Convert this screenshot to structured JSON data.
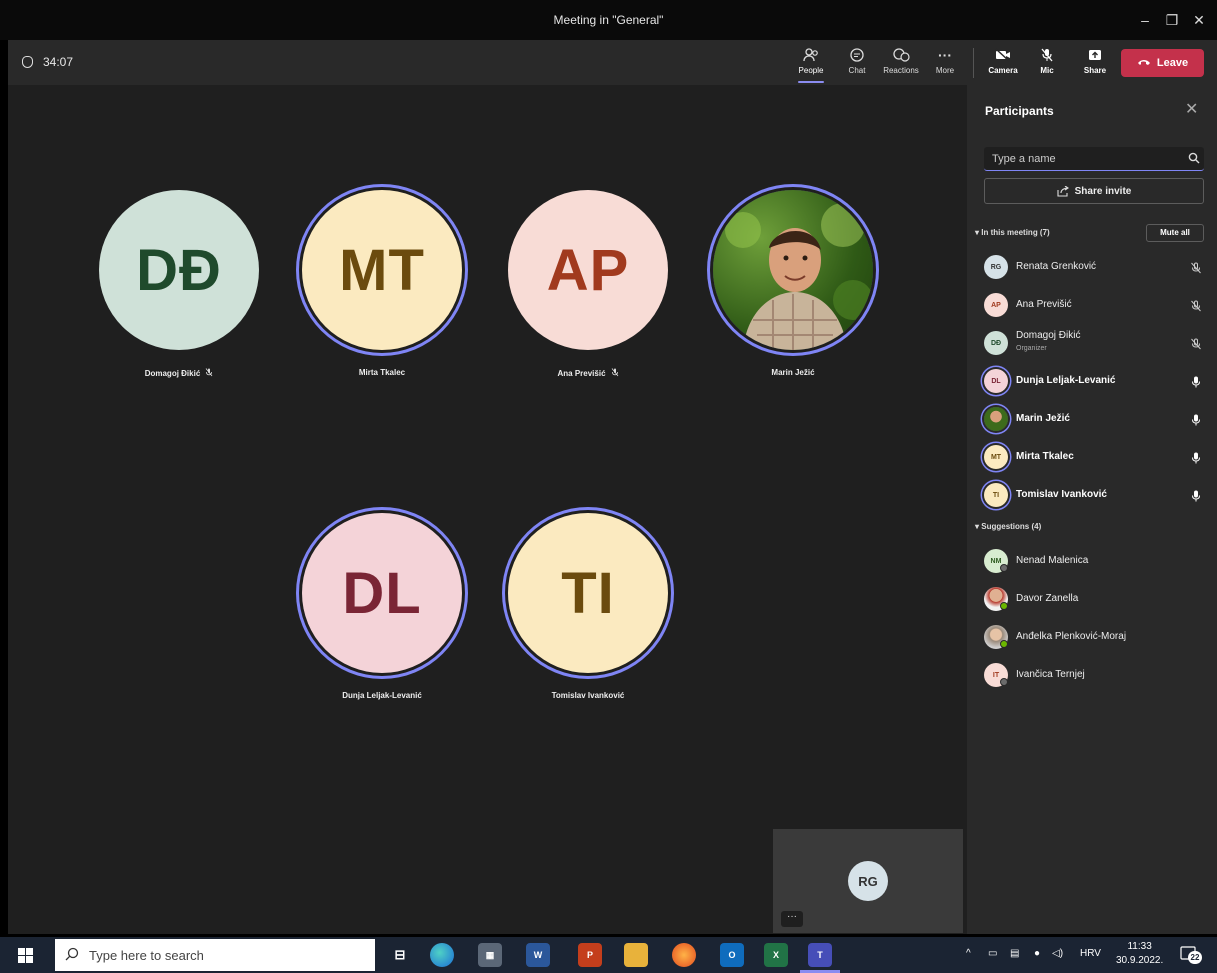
{
  "window": {
    "title": "Meeting in \"General\"",
    "minimize_label": "–",
    "restore_label": "❐",
    "close_label": "✕"
  },
  "toolbar": {
    "timer": "34:07",
    "people": "People",
    "chat": "Chat",
    "reactions": "Reactions",
    "more": "More",
    "camera": "Camera",
    "mic": "Mic",
    "share": "Share",
    "leave": "Leave"
  },
  "stage": {
    "tiles": [
      {
        "initials": "DĐ",
        "name": "Domagoj Đikić",
        "bg": "#cfe1d8",
        "fg": "#1f4a2c",
        "muted": true,
        "speaking": false
      },
      {
        "initials": "MT",
        "name": "Mirta Tkalec",
        "bg": "#fbeac0",
        "fg": "#6b4b0e",
        "muted": false,
        "speaking": true
      },
      {
        "initials": "AP",
        "name": "Ana Previšić",
        "bg": "#f8dcd6",
        "fg": "#a13a1e",
        "muted": true,
        "speaking": false
      },
      {
        "initials": "",
        "name": "Marin Ježić",
        "photo": true,
        "muted": false,
        "speaking": true
      },
      {
        "initials": "DL",
        "name": "Dunja Leljak-Levanić",
        "bg": "#f4d3d8",
        "fg": "#7a2535",
        "muted": false,
        "speaking": true
      },
      {
        "initials": "TI",
        "name": "Tomislav Ivanković",
        "bg": "#fbeac0",
        "fg": "#6b4b0e",
        "muted": false,
        "speaking": true
      }
    ],
    "self_view": {
      "initials": "RG",
      "more_label": "···"
    }
  },
  "panel": {
    "title": "Participants",
    "close_label": "✕",
    "search_placeholder": "Type a name",
    "share_invite": "Share invite",
    "in_meeting_label": "In this meeting (7)",
    "mute_all": "Mute all",
    "suggestions_label": "Suggestions (4)",
    "participants": [
      {
        "initials": "RG",
        "name": "Renata Grenković",
        "sub": "",
        "bg": "#d6e2e8",
        "fg": "#333",
        "bold": false,
        "mic": "muted",
        "ring": false
      },
      {
        "initials": "AP",
        "name": "Ana Previšić",
        "sub": "",
        "bg": "#f8dcd6",
        "fg": "#a13a1e",
        "bold": false,
        "mic": "muted",
        "ring": false
      },
      {
        "initials": "DĐ",
        "name": "Domagoj Đikić",
        "sub": "Organizer",
        "bg": "#cfe1d8",
        "fg": "#1f4a2c",
        "bold": false,
        "mic": "muted",
        "ring": false
      },
      {
        "initials": "DL",
        "name": "Dunja Leljak-Levanić",
        "sub": "",
        "bg": "#f4d3d8",
        "fg": "#7a2535",
        "bold": true,
        "mic": "on",
        "ring": true
      },
      {
        "initials": "",
        "name": "Marin Ježić",
        "sub": "",
        "photo": true,
        "bold": true,
        "mic": "on",
        "ring": true
      },
      {
        "initials": "MT",
        "name": "Mirta Tkalec",
        "sub": "",
        "bg": "#fbeac0",
        "fg": "#6b4b0e",
        "bold": true,
        "mic": "on",
        "ring": true
      },
      {
        "initials": "TI",
        "name": "Tomislav Ivanković",
        "sub": "",
        "bg": "#fbeac0",
        "fg": "#6b4b0e",
        "bold": true,
        "mic": "on",
        "ring": true
      }
    ],
    "suggestions": [
      {
        "initials": "NM",
        "name": "Nenad Malenica",
        "bg": "#d8ecd0",
        "fg": "#2d5a1f",
        "status": "#6b6b6b"
      },
      {
        "initials": "",
        "name": "Davor Zanella",
        "photo": "davor",
        "status": "#6bb700"
      },
      {
        "initials": "",
        "name": "Anđelka Plenković-Moraj",
        "photo": "andelka",
        "status": "#6bb700"
      },
      {
        "initials": "IT",
        "name": "Ivančica Ternjej",
        "bg": "#f8dcd6",
        "fg": "#a13a1e",
        "status": "#6b6b6b"
      }
    ]
  },
  "taskbar": {
    "search_placeholder": "Type here to search",
    "language": "HRV",
    "time": "11:33",
    "date": "30.9.2022.",
    "notifications": "22"
  }
}
